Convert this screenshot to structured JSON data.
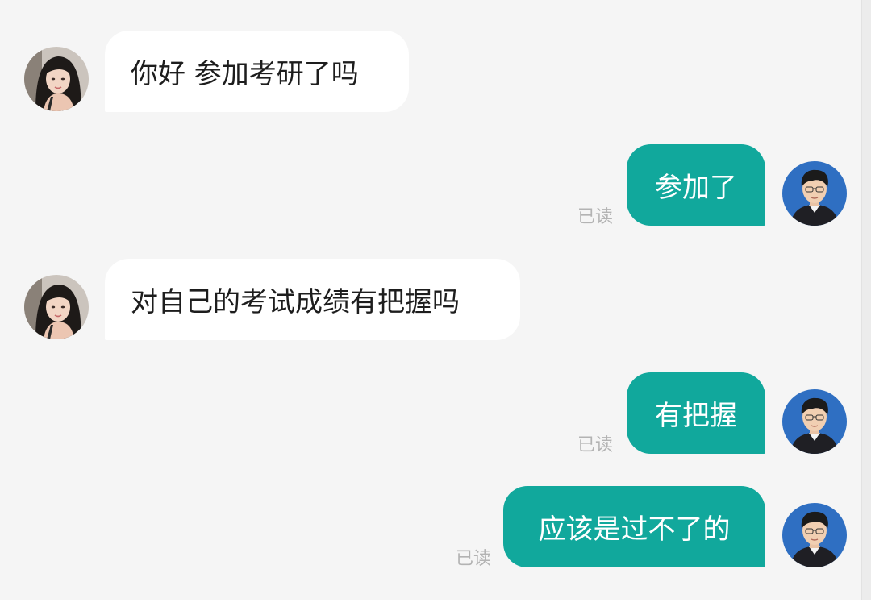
{
  "messages": [
    {
      "sender": "other",
      "text": "你好 参加考研了吗"
    },
    {
      "sender": "me",
      "text": "参加了",
      "status": "已读"
    },
    {
      "sender": "other",
      "text": "对自己的考试成绩有把握吗"
    },
    {
      "sender": "me",
      "text": "有把握",
      "status": "已读"
    },
    {
      "sender": "me",
      "text": "应该是过不了的",
      "status": "已读"
    }
  ],
  "colors": {
    "background": "#f5f5f5",
    "incoming_bubble": "#ffffff",
    "outgoing_bubble": "#11a89c",
    "read_status": "#b3b3b3"
  },
  "icons": {
    "incoming_avatar": "female-user-avatar",
    "outgoing_avatar": "male-user-avatar"
  }
}
